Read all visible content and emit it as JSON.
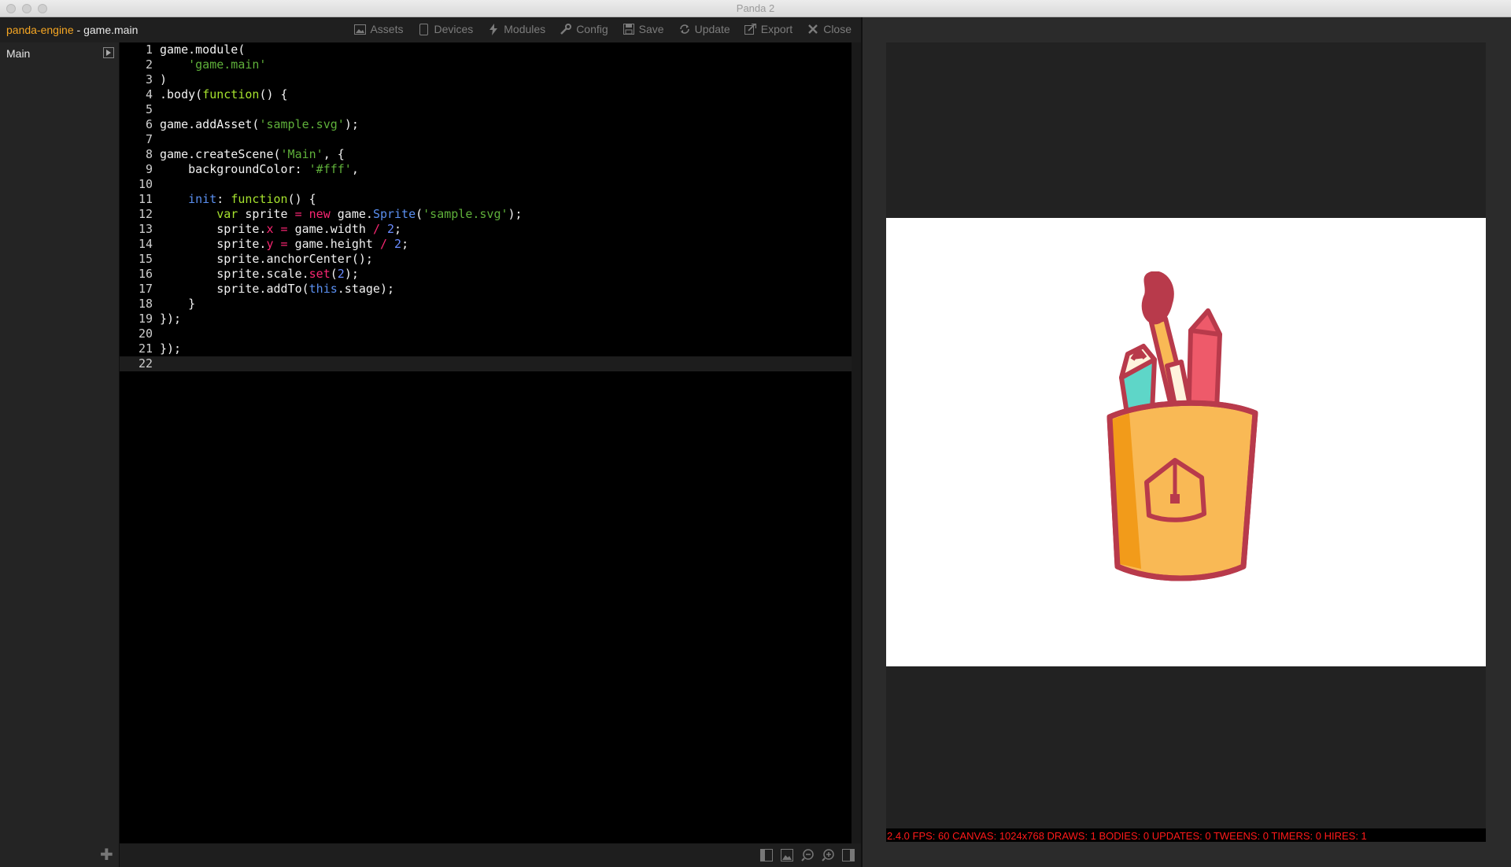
{
  "window": {
    "title": "Panda 2"
  },
  "project": {
    "name": "panda-engine",
    "separator": " - ",
    "file": "game.main"
  },
  "toolbar": {
    "items": [
      {
        "label": "Assets",
        "icon": "image-icon"
      },
      {
        "label": "Devices",
        "icon": "device-icon"
      },
      {
        "label": "Modules",
        "icon": "bolt-icon"
      },
      {
        "label": "Config",
        "icon": "wrench-icon"
      },
      {
        "label": "Save",
        "icon": "save-icon"
      },
      {
        "label": "Update",
        "icon": "refresh-icon"
      },
      {
        "label": "Export",
        "icon": "export-icon"
      },
      {
        "label": "Close",
        "icon": "close-icon"
      }
    ]
  },
  "sidebar": {
    "items": [
      {
        "label": "Main"
      }
    ]
  },
  "editor": {
    "active_line": 22,
    "lines": [
      {
        "n": "1",
        "segs": [
          {
            "t": "game.module("
          }
        ]
      },
      {
        "n": "2",
        "segs": [
          {
            "t": "    "
          },
          {
            "t": "'game.main'",
            "c": "k-str"
          }
        ]
      },
      {
        "n": "3",
        "segs": [
          {
            "t": ")"
          }
        ]
      },
      {
        "n": "4",
        "segs": [
          {
            "t": ".body("
          },
          {
            "t": "function",
            "c": "k-fn"
          },
          {
            "t": "() {"
          }
        ]
      },
      {
        "n": "5",
        "segs": []
      },
      {
        "n": "6",
        "segs": [
          {
            "t": "game.addAsset("
          },
          {
            "t": "'sample.svg'",
            "c": "k-str"
          },
          {
            "t": ");"
          }
        ]
      },
      {
        "n": "7",
        "segs": []
      },
      {
        "n": "8",
        "segs": [
          {
            "t": "game.createScene("
          },
          {
            "t": "'Main'",
            "c": "k-str"
          },
          {
            "t": ", {"
          }
        ]
      },
      {
        "n": "9",
        "segs": [
          {
            "t": "    backgroundColor: "
          },
          {
            "t": "'#fff'",
            "c": "k-str"
          },
          {
            "t": ","
          }
        ]
      },
      {
        "n": "10",
        "segs": []
      },
      {
        "n": "11",
        "segs": [
          {
            "t": "    "
          },
          {
            "t": "init",
            "c": "k-blue"
          },
          {
            "t": ": "
          },
          {
            "t": "function",
            "c": "k-fn"
          },
          {
            "t": "() {"
          }
        ]
      },
      {
        "n": "12",
        "segs": [
          {
            "t": "        "
          },
          {
            "t": "var",
            "c": "k-fn"
          },
          {
            "t": " sprite "
          },
          {
            "t": "=",
            "c": "k-op"
          },
          {
            "t": " "
          },
          {
            "t": "new",
            "c": "k-op"
          },
          {
            "t": " game."
          },
          {
            "t": "Sprite",
            "c": "k-blue"
          },
          {
            "t": "("
          },
          {
            "t": "'sample.svg'",
            "c": "k-str"
          },
          {
            "t": ");"
          }
        ]
      },
      {
        "n": "13",
        "segs": [
          {
            "t": "        sprite."
          },
          {
            "t": "x",
            "c": "k-prop"
          },
          {
            "t": " "
          },
          {
            "t": "=",
            "c": "k-op"
          },
          {
            "t": " game.width "
          },
          {
            "t": "/",
            "c": "k-op"
          },
          {
            "t": " "
          },
          {
            "t": "2",
            "c": "k-num"
          },
          {
            "t": ";"
          }
        ]
      },
      {
        "n": "14",
        "segs": [
          {
            "t": "        sprite."
          },
          {
            "t": "y",
            "c": "k-prop"
          },
          {
            "t": " "
          },
          {
            "t": "=",
            "c": "k-op"
          },
          {
            "t": " game.height "
          },
          {
            "t": "/",
            "c": "k-op"
          },
          {
            "t": " "
          },
          {
            "t": "2",
            "c": "k-num"
          },
          {
            "t": ";"
          }
        ]
      },
      {
        "n": "15",
        "segs": [
          {
            "t": "        sprite.anchorCenter();"
          }
        ]
      },
      {
        "n": "16",
        "segs": [
          {
            "t": "        sprite.scale."
          },
          {
            "t": "set",
            "c": "k-prop"
          },
          {
            "t": "("
          },
          {
            "t": "2",
            "c": "k-num"
          },
          {
            "t": ");"
          }
        ]
      },
      {
        "n": "17",
        "segs": [
          {
            "t": "        sprite.addTo("
          },
          {
            "t": "this",
            "c": "k-blue"
          },
          {
            "t": ".stage);"
          }
        ]
      },
      {
        "n": "18",
        "segs": [
          {
            "t": "    }"
          }
        ]
      },
      {
        "n": "19",
        "segs": [
          {
            "t": "});"
          }
        ]
      },
      {
        "n": "20",
        "segs": []
      },
      {
        "n": "21",
        "segs": [
          {
            "t": "});"
          }
        ]
      },
      {
        "n": "22",
        "segs": []
      }
    ]
  },
  "preview": {
    "stats": "2.4.0 FPS: 60 CANVAS: 1024x768 DRAWS: 1 BODIES: 0 UPDATES: 0 TWEENS: 0 TIMERS: 0 HIRES: 1",
    "sprite_icon": "pencil-cup-icon"
  },
  "colors": {
    "accent": "#f5a623",
    "stats": "#ff1a1a",
    "cup": "#f9b955",
    "outline": "#b83a4b"
  }
}
